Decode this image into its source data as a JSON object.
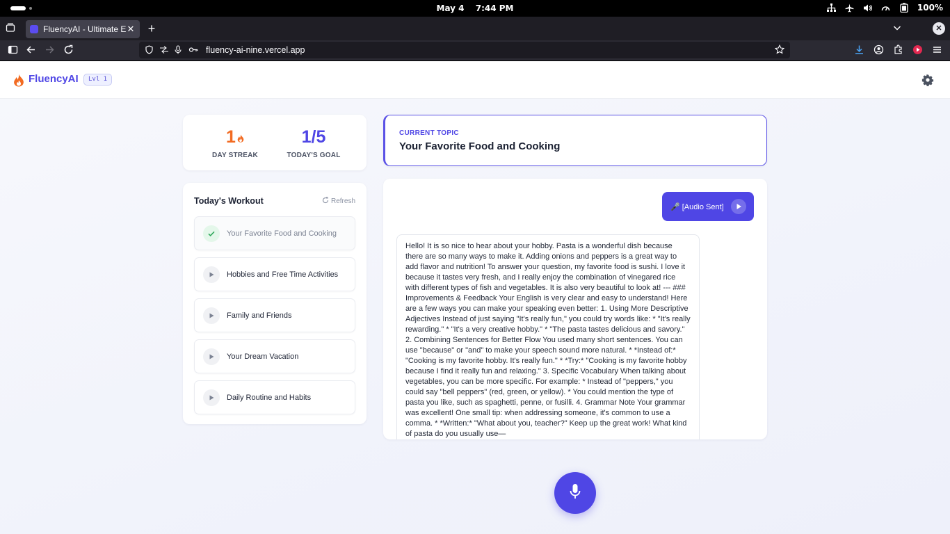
{
  "os": {
    "date": "May 4",
    "time": "7:44 PM",
    "battery": "100%"
  },
  "browser": {
    "tab_title": "FluencyAI - Ultimate Edi",
    "url": "fluency-ai-nine.vercel.app",
    "new_tab_glyph": "+",
    "close_glyph": "✕"
  },
  "app": {
    "brand": "FluencyAI",
    "level": "Lvl 1",
    "accent": "#4f46e5",
    "streak_color": "#f26b22"
  },
  "stats": {
    "streak_value": "1",
    "streak_label": "DAY STREAK",
    "goal_value": "1/5",
    "goal_label": "TODAY'S GOAL"
  },
  "topic": {
    "kicker": "CURRENT TOPIC",
    "title": "Your Favorite Food and Cooking"
  },
  "workout": {
    "title": "Today's Workout",
    "refresh": "Refresh",
    "items": [
      {
        "label": "Your Favorite Food and Cooking",
        "status": "done",
        "icon": "check-icon"
      },
      {
        "label": "Hobbies and Free Time Activities",
        "status": "todo",
        "icon": "play-icon"
      },
      {
        "label": "Family and Friends",
        "status": "todo",
        "icon": "play-icon"
      },
      {
        "label": "Your Dream Vacation",
        "status": "todo",
        "icon": "play-icon"
      },
      {
        "label": "Daily Routine and Habits",
        "status": "todo",
        "icon": "play-icon"
      }
    ]
  },
  "chat": {
    "user_message": "🎤 [Audio Sent]",
    "ai_message": "Hello! It is so nice to hear about your hobby. Pasta is a wonderful dish because there are so many ways to make it. Adding onions and peppers is a great way to add flavor and nutrition! To answer your question, my favorite food is sushi. I love it because it tastes very fresh, and I really enjoy the combination of vinegared rice with different types of fish and vegetables. It is also very beautiful to look at! --- ### Improvements & Feedback Your English is very clear and easy to understand! Here are a few ways you can make your speaking even better: 1. Using More Descriptive Adjectives Instead of just saying \"It's really fun,\" you could try words like: * \"It's really rewarding.\" * \"It's a very creative hobby.\" * \"The pasta tastes delicious and savory.\" 2. Combining Sentences for Better Flow You used many short sentences. You can use \"because\" or \"and\" to make your speech sound more natural. * *Instead of:* \"Cooking is my favorite hobby. It's really fun.\" * *Try:* \"Cooking is my favorite hobby because I find it really fun and relaxing.\" 3. Specific Vocabulary When talking about vegetables, you can be more specific. For example: * Instead of \"peppers,\" you could say \"bell peppers\" (red, green, or yellow). * You could mention the type of pasta you like, such as spaghetti, penne, or fusilli. 4. Grammar Note Your grammar was excellent! One small tip: when addressing someone, it's common to use a comma. * *Written:* \"What about you, teacher?\" Keep up the great work! What kind of pasta do you usually use—"
  }
}
